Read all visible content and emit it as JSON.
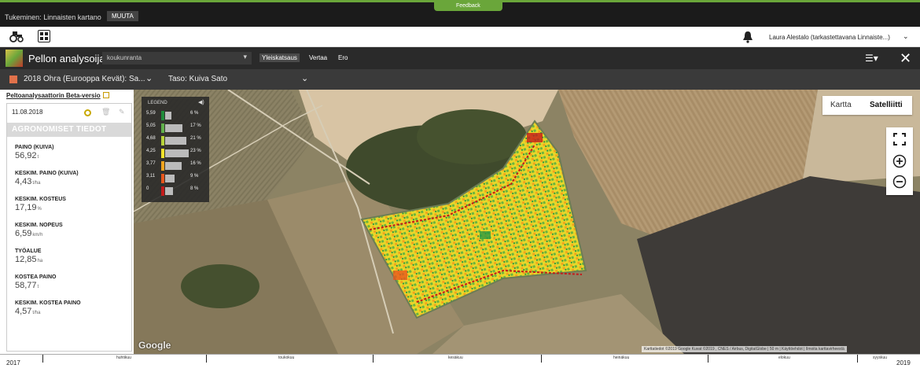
{
  "topbar": {
    "feedback": "Feedback",
    "breadcrumb": "Tukeminen: Linnaisten kartano",
    "tag": "MUUTA"
  },
  "header": {
    "user": "Laura Alestalo (tarkastettavana Linnaiste...)"
  },
  "app": {
    "title": "Pellon analysoija",
    "field": "koukunranta",
    "tabs": [
      "Yleiskatsaus",
      "Vertaa",
      "Ero"
    ]
  },
  "layer": {
    "label": "2018 Ohra (Eurooppa Kevät): Sa...",
    "taso": "Taso: Kuiva Sato",
    "swatch_color": "#e0714a"
  },
  "beta_link": "Peltoanalysaattorin Beta-versio",
  "panel": {
    "date": "11.08.2018",
    "heading": "AGRONOMISET TIEDOT",
    "metrics": [
      {
        "label": "PAINO (KUIVA)",
        "value": "56,92",
        "unit": "t"
      },
      {
        "label": "KESKIM. PAINO (KUIVA)",
        "value": "4,43",
        "unit": "t/ha"
      },
      {
        "label": "KESKIM. KOSTEUS",
        "value": "17,19",
        "unit": "%"
      },
      {
        "label": "KESKIM. NOPEUS",
        "value": "6,59",
        "unit": "km/h"
      },
      {
        "label": "TYÖALUE",
        "value": "12,85",
        "unit": "ha"
      },
      {
        "label": "KOSTEA PAINO",
        "value": "58,77",
        "unit": "t"
      },
      {
        "label": "KESKIM. KOSTEA PAINO",
        "value": "4,57",
        "unit": "t/ha"
      }
    ]
  },
  "legend": {
    "title": "LEGEND",
    "rows": [
      {
        "value": "5,59",
        "pct": "6 %",
        "share": 6,
        "color": "#1e8c3a"
      },
      {
        "value": "5,05",
        "pct": "17 %",
        "share": 17,
        "color": "#5fb04a"
      },
      {
        "value": "4,68",
        "pct": "21 %",
        "share": 21,
        "color": "#b6d33a"
      },
      {
        "value": "4,25",
        "pct": "23 %",
        "share": 23,
        "color": "#f2e22a"
      },
      {
        "value": "3,77",
        "pct": "16 %",
        "share": 16,
        "color": "#f2a41e"
      },
      {
        "value": "3,11",
        "pct": "9 %",
        "share": 9,
        "color": "#e8561c"
      },
      {
        "value": "0",
        "pct": "8 %",
        "share": 8,
        "color": "#c41a1a"
      }
    ]
  },
  "map": {
    "type_buttons": [
      "Kartta",
      "Satelliitti"
    ],
    "google": "Google",
    "attribution": "Karttatiedot ©2019 Google Kuvat ©2019 , CNES / Airbus, DigitalGlobe | 50 m | Käyttöehdot | Ilmoita karttavirheestä"
  },
  "timeline": {
    "start_year": "2017",
    "end_year": "2019",
    "months": [
      "huhtikuu",
      "toukokuu",
      "kesäkuu",
      "heinäkuu",
      "elokuu",
      "syyskuu"
    ]
  }
}
